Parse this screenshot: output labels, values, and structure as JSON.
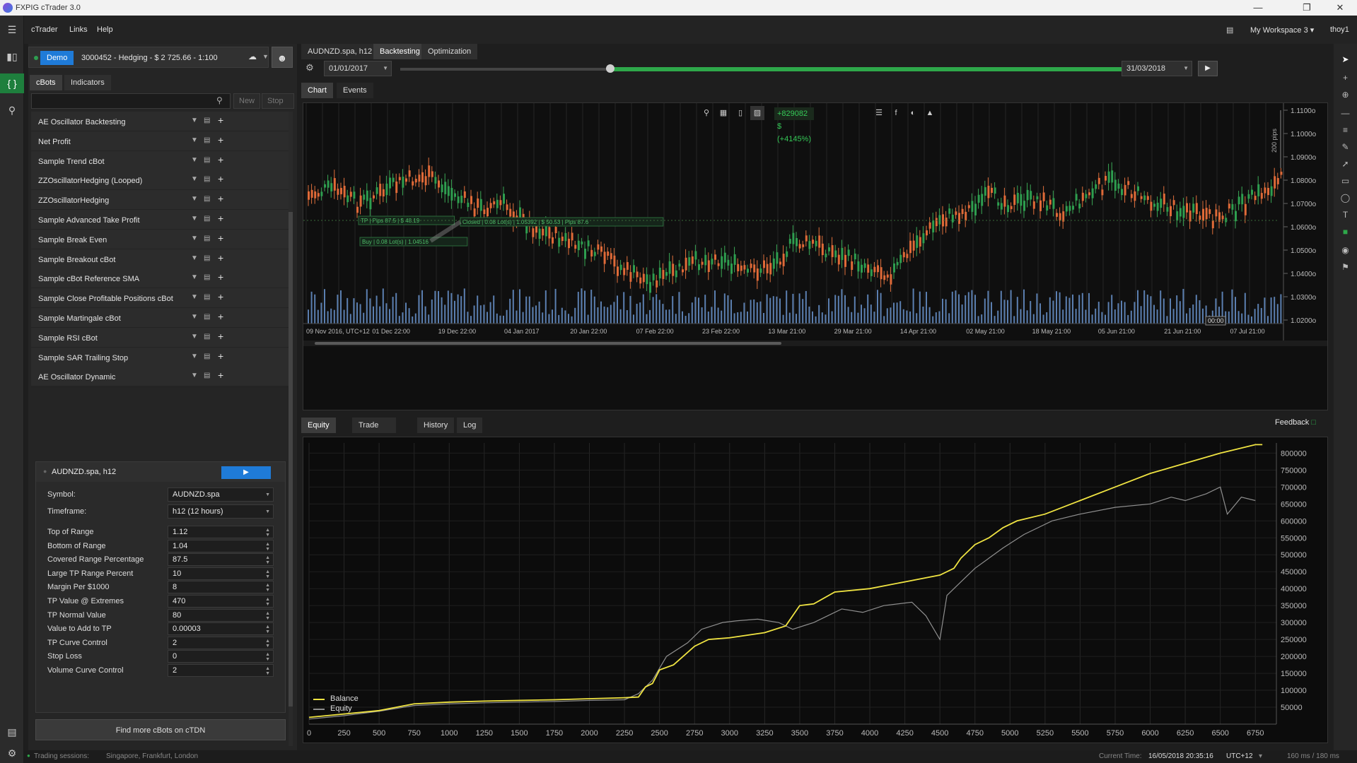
{
  "window": {
    "title": "FXPIG cTrader 3.0"
  },
  "menu": {
    "items": [
      "cTrader",
      "Links",
      "Help"
    ],
    "workspace": "My Workspace 3",
    "user": "thoy1"
  },
  "account": {
    "type": "Demo",
    "info": "3000452 - Hedging - $ 2 725.66 - 1:100"
  },
  "left_tabs": [
    "cBots",
    "Indicators"
  ],
  "list_actions": {
    "new": "New",
    "stop_all": "Stop All"
  },
  "bots": [
    "AE Oscillator Backtesting",
    "Net Profit",
    "Sample Trend cBot",
    "ZZOscillatorHedging (Looped)",
    "ZZOscillatorHedging",
    "Sample Advanced Take Profit",
    "Sample Break Even",
    "Sample Breakout cBot",
    "Sample cBot Reference SMA",
    "Sample Close Profitable Positions cBot",
    "Sample Martingale cBot",
    "Sample RSI cBot",
    "Sample SAR Trailing Stop",
    "AE Oscillator Dynamic"
  ],
  "instance": {
    "title": "AUDNZD.spa, h12",
    "symbol_label": "Symbol:",
    "symbol_value": "AUDNZD.spa",
    "timeframe_label": "Timeframe:",
    "timeframe_value": "h12 (12 hours)",
    "params": [
      {
        "k": "Top of Range",
        "v": "1.12"
      },
      {
        "k": "Bottom of Range",
        "v": "1.04"
      },
      {
        "k": "Covered Range Percentage",
        "v": "87.5"
      },
      {
        "k": "Large TP Range Percent",
        "v": "10"
      },
      {
        "k": "Margin Per $1000",
        "v": "8"
      },
      {
        "k": "TP Value @ Extremes",
        "v": "470"
      },
      {
        "k": "TP Normal Value",
        "v": "80"
      },
      {
        "k": "Value to Add to TP",
        "v": "0.00003"
      },
      {
        "k": "TP Curve Control",
        "v": "2"
      },
      {
        "k": "Stop Loss",
        "v": "0"
      },
      {
        "k": "Volume Curve Control",
        "v": "2"
      }
    ]
  },
  "find_more": "Find more cBots on cTDN",
  "top_tabs": [
    "AUDNZD.spa, h12",
    "Backtesting",
    "Optimization"
  ],
  "backtest": {
    "start": "01/01/2017",
    "end": "31/03/2018",
    "range_start": 0.27,
    "range_end": 0.99
  },
  "chart_tabs": [
    "Chart",
    "Events"
  ],
  "profit_badge": "+829082 $ (+4145%)",
  "price_chart": {
    "type": "candlestick",
    "y_ticks": [
      "1.1100o",
      "1.1000o",
      "1.0900o",
      "1.0800o",
      "1.0700o",
      "1.0600o",
      "1.0500o",
      "1.0400o",
      "1.0300o",
      "1.0200o"
    ],
    "x_ticks": [
      "09 Nov 2016, UTC+12",
      "01 Dec 22:00",
      "19 Dec 22:00",
      "04 Jan 2017",
      "20 Jan 22:00",
      "07 Feb 22:00",
      "23 Feb 22:00",
      "13 Mar 21:00",
      "29 Mar 21:00",
      "14 Apr 21:00",
      "02 May 21:00",
      "18 May 21:00",
      "05 Jun 21:00",
      "21 Jun 21:00",
      "07 Jul 21:00"
    ],
    "scale_label": "200 pips",
    "cursor_time": "00:00",
    "trade_labels": {
      "tp": "TP | Pips 87.5 | $ 48.19",
      "buy": "Buy | 0.08 Lot(s) | 1.04516",
      "closed": "Closed | 0.08 Lot(s) | 1.05392 | $ 50.53 | Pips 87.6"
    }
  },
  "bottom_tabs": [
    "Equity Chart",
    "Trade Statistics",
    "History",
    "Log"
  ],
  "feedback": "Feedback",
  "chart_data": {
    "type": "line",
    "x_ticks": [
      "0",
      "250",
      "500",
      "750",
      "1000",
      "1250",
      "1500",
      "1750",
      "2000",
      "2250",
      "2500",
      "2750",
      "3000",
      "3250",
      "3500",
      "3750",
      "4000",
      "4250",
      "4500",
      "4750",
      "5000",
      "5250",
      "5500",
      "5750",
      "6000",
      "6250",
      "6500",
      "6750"
    ],
    "y_ticks": [
      "800000",
      "750000",
      "700000",
      "650000",
      "600000",
      "550000",
      "500000",
      "450000",
      "400000",
      "350000",
      "300000",
      "250000",
      "200000",
      "150000",
      "100000",
      "50000"
    ],
    "xlim": [
      0,
      6900
    ],
    "ylim": [
      0,
      830000
    ],
    "series": [
      {
        "name": "Balance",
        "color": "#f0e442",
        "x": [
          0,
          250,
          500,
          750,
          1000,
          1250,
          1500,
          1750,
          2000,
          2250,
          2350,
          2400,
          2450,
          2500,
          2600,
          2750,
          2850,
          3000,
          3250,
          3400,
          3500,
          3600,
          3750,
          4000,
          4250,
          4500,
          4600,
          4650,
          4750,
          4850,
          4950,
          5050,
          5250,
          5500,
          5750,
          6000,
          6250,
          6500,
          6600,
          6750,
          6800
        ],
        "y": [
          20000,
          30000,
          40000,
          60000,
          65000,
          68000,
          70000,
          72000,
          75000,
          78000,
          80000,
          110000,
          120000,
          160000,
          175000,
          230000,
          250000,
          255000,
          270000,
          290000,
          350000,
          355000,
          390000,
          400000,
          420000,
          440000,
          460000,
          490000,
          530000,
          550000,
          580000,
          600000,
          620000,
          660000,
          700000,
          740000,
          770000,
          800000,
          810000,
          825000,
          825000
        ]
      },
      {
        "name": "Equity",
        "color": "#8f8f8f",
        "x": [
          0,
          250,
          500,
          750,
          1000,
          1250,
          1500,
          1750,
          2000,
          2250,
          2350,
          2450,
          2550,
          2700,
          2800,
          2950,
          3050,
          3200,
          3350,
          3450,
          3600,
          3700,
          3800,
          3950,
          4100,
          4300,
          4400,
          4500,
          4550,
          4650,
          4750,
          4850,
          4950,
          5100,
          5300,
          5500,
          5750,
          6000,
          6150,
          6250,
          6400,
          6500,
          6550,
          6650,
          6750
        ],
        "y": [
          15000,
          25000,
          38000,
          55000,
          60000,
          63000,
          65000,
          67000,
          70000,
          72000,
          90000,
          130000,
          200000,
          240000,
          280000,
          300000,
          305000,
          310000,
          300000,
          280000,
          300000,
          320000,
          340000,
          330000,
          350000,
          360000,
          320000,
          250000,
          380000,
          420000,
          460000,
          490000,
          520000,
          560000,
          600000,
          620000,
          640000,
          650000,
          670000,
          660000,
          680000,
          700000,
          620000,
          670000,
          660000
        ]
      }
    ]
  },
  "status": {
    "sessions_label": "Trading sessions:",
    "sessions": "Singapore, Frankfurt, London",
    "current_time_label": "Current Time:",
    "current_time": "16/05/2018 20:35:16",
    "tz": "UTC+12",
    "latency": "160 ms / 180 ms"
  }
}
